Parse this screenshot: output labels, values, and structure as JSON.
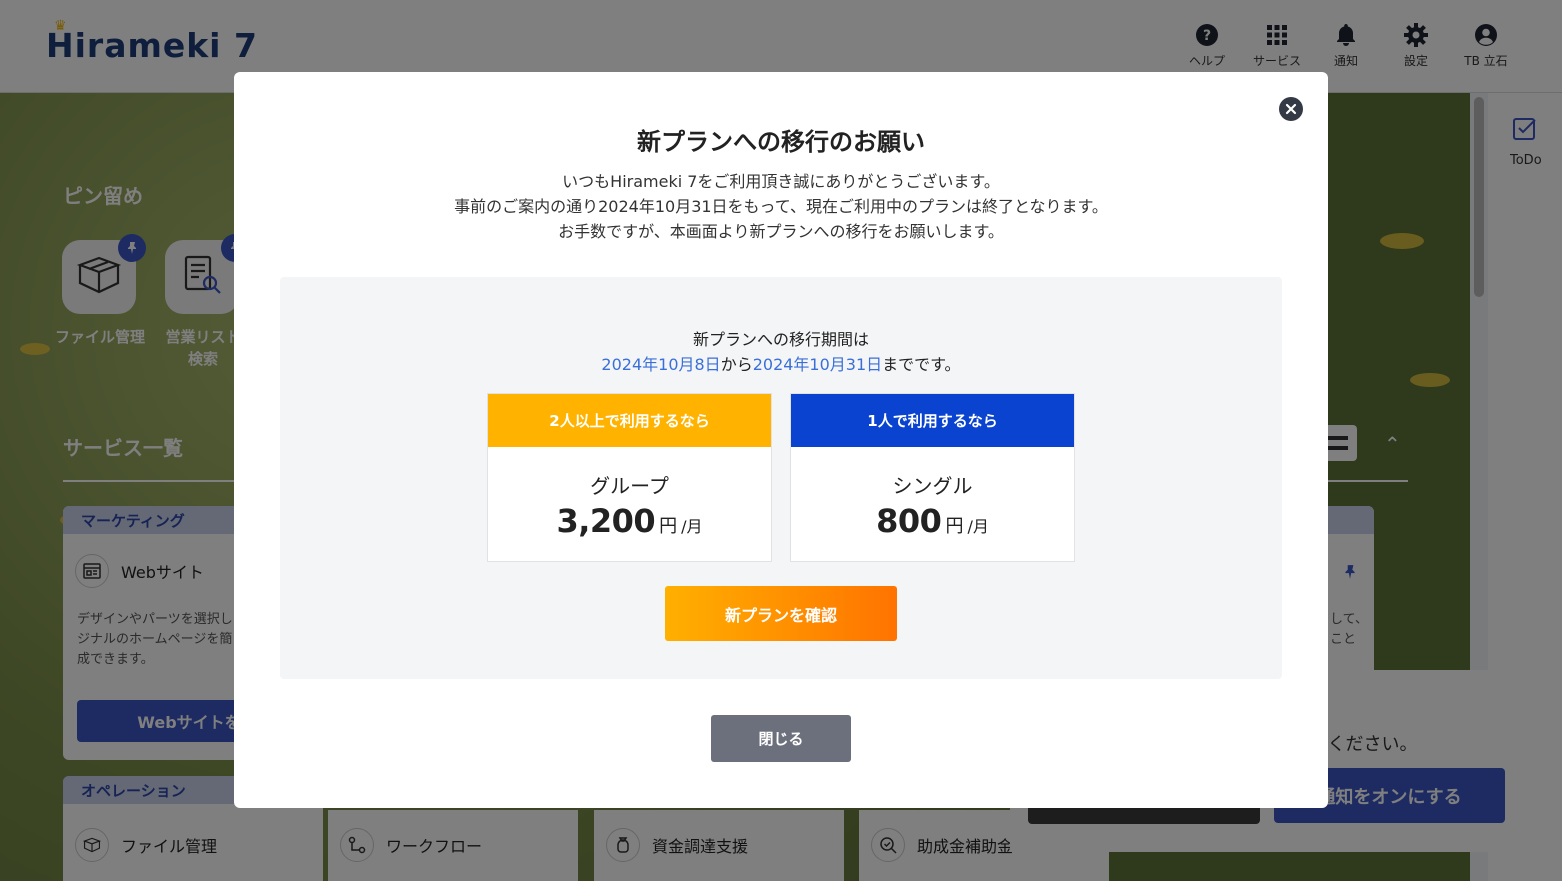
{
  "header": {
    "logo": "Hirameki 7",
    "nav": [
      {
        "label": "ヘルプ",
        "icon": "help-icon"
      },
      {
        "label": "サービス",
        "icon": "apps-grid-icon"
      },
      {
        "label": "通知",
        "icon": "bell-icon"
      },
      {
        "label": "設定",
        "icon": "gear-icon"
      },
      {
        "label": "TB 立石",
        "icon": "user-icon"
      }
    ]
  },
  "background": {
    "pinned_title": "ピン留め",
    "pinned": [
      {
        "label": "ファイル管理",
        "icon": "box-icon"
      },
      {
        "label": "営業リスト\n検索",
        "icon": "list-search-icon"
      }
    ],
    "services_title": "サービス一覧",
    "categories": [
      {
        "name": "マーケティング",
        "item": "Webサイト",
        "desc": [
          "デザインやパーツを選択し",
          "ジナルのホームページを簡",
          "成できます。"
        ],
        "button": "Webサイトを開"
      },
      {
        "name": "オペレーション"
      }
    ],
    "bottom_items": [
      "ファイル管理",
      "ワークフロー",
      "資金調達支援",
      "助成金補助金"
    ],
    "right_fragment": [
      "して、",
      "こと"
    ],
    "todo_label": "ToDo",
    "notification": {
      "text": "てください。",
      "on_button": "通知をオンにする"
    }
  },
  "modal": {
    "title": "新プランへの移行のお願い",
    "messages": [
      "いつもHirameki 7をご利用頂き誠にありがとうございます。",
      "事前のご案内の通り2024年10月31日をもって、現在ご利用中のプランは終了となります。",
      "お手数ですが、本画面より新プランへの移行をお願いします。"
    ],
    "period_intro": "新プランへの移行期間は",
    "period_start": "2024年10月8日",
    "period_from": "から",
    "period_end": "2024年10月31日",
    "period_suffix": "までです。",
    "plans": [
      {
        "header": "2人以上で利用するなら",
        "name": "グループ",
        "price": "3,200",
        "unit": "円",
        "per": "/月",
        "color": "#ffb300"
      },
      {
        "header": "1人で利用するなら",
        "name": "シングル",
        "price": "800",
        "unit": "円",
        "per": "/月",
        "color": "#0a43d0"
      }
    ],
    "confirm_button": "新プランを確認",
    "close_button": "閉じる"
  }
}
